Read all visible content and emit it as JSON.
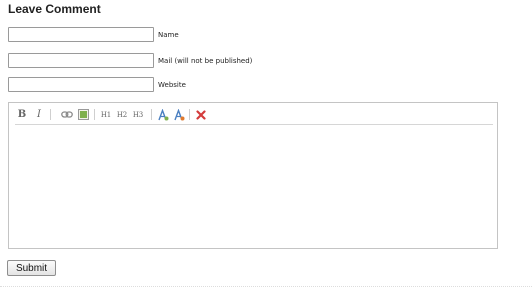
{
  "form": {
    "heading": "Leave Comment",
    "fields": [
      {
        "value": "",
        "label": "Name"
      },
      {
        "value": "",
        "label": "Mail (will not be published)"
      },
      {
        "value": "",
        "label": "Website"
      }
    ]
  },
  "toolbar": {
    "bold": "B",
    "italic": "I",
    "h1": "H1",
    "h2": "H2",
    "h3": "H3",
    "icons": [
      "link-icon",
      "image-icon",
      "font-color-icon",
      "clear-format-icon",
      "delete-icon"
    ]
  },
  "editor": {
    "content": ""
  },
  "submit": {
    "label": "Submit"
  },
  "colors": {
    "image_icon": "#7fb04d",
    "font_icon": "#4a7fc1",
    "delete_icon": "#d43b3b"
  }
}
